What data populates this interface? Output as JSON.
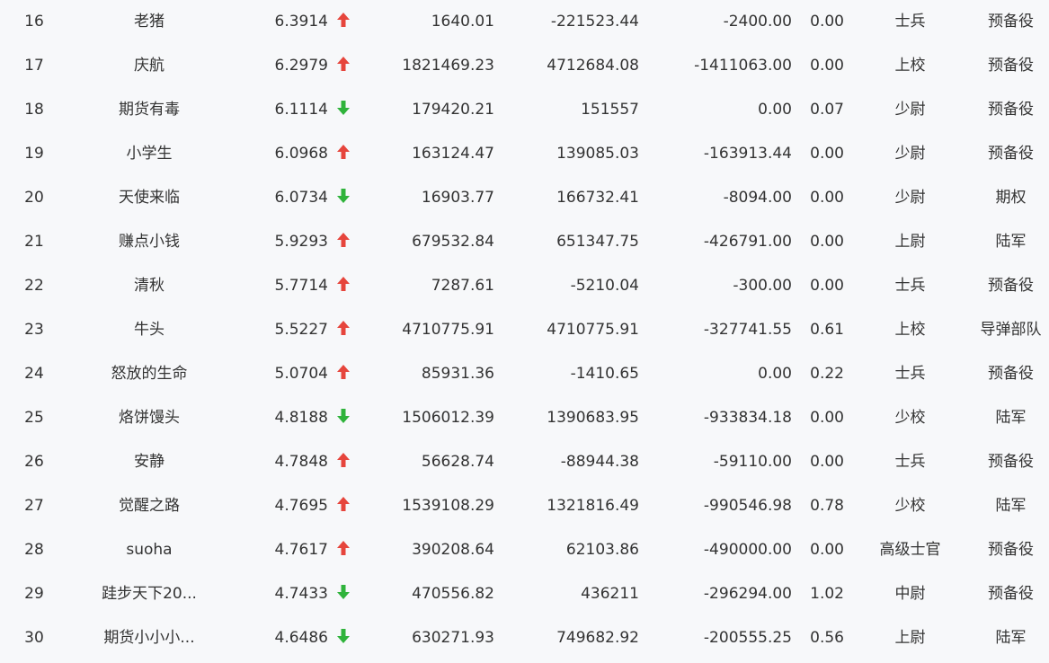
{
  "colors": {
    "up": "#e6453c",
    "down": "#2fb33b"
  },
  "rows": [
    {
      "rank": "16",
      "name": "老猪",
      "score": "6.3914",
      "trend": "up",
      "v1": "1640.01",
      "v2": "-221523.44",
      "v3": "-2400.00",
      "v4": "0.00",
      "rank_title": "士兵",
      "unit": "预备役"
    },
    {
      "rank": "17",
      "name": "庆航",
      "score": "6.2979",
      "trend": "up",
      "v1": "1821469.23",
      "v2": "4712684.08",
      "v3": "-1411063.00",
      "v4": "0.00",
      "rank_title": "上校",
      "unit": "预备役"
    },
    {
      "rank": "18",
      "name": "期货有毒",
      "score": "6.1114",
      "trend": "down",
      "v1": "179420.21",
      "v2": "151557",
      "v3": "0.00",
      "v4": "0.07",
      "rank_title": "少尉",
      "unit": "预备役"
    },
    {
      "rank": "19",
      "name": "小学生",
      "score": "6.0968",
      "trend": "up",
      "v1": "163124.47",
      "v2": "139085.03",
      "v3": "-163913.44",
      "v4": "0.00",
      "rank_title": "少尉",
      "unit": "预备役"
    },
    {
      "rank": "20",
      "name": "天使来临",
      "score": "6.0734",
      "trend": "down",
      "v1": "16903.77",
      "v2": "166732.41",
      "v3": "-8094.00",
      "v4": "0.00",
      "rank_title": "少尉",
      "unit": "期权"
    },
    {
      "rank": "21",
      "name": "赚点小钱",
      "score": "5.9293",
      "trend": "up",
      "v1": "679532.84",
      "v2": "651347.75",
      "v3": "-426791.00",
      "v4": "0.00",
      "rank_title": "上尉",
      "unit": "陆军"
    },
    {
      "rank": "22",
      "name": "清秋",
      "score": "5.7714",
      "trend": "up",
      "v1": "7287.61",
      "v2": "-5210.04",
      "v3": "-300.00",
      "v4": "0.00",
      "rank_title": "士兵",
      "unit": "预备役"
    },
    {
      "rank": "23",
      "name": "牛头",
      "score": "5.5227",
      "trend": "up",
      "v1": "4710775.91",
      "v2": "4710775.91",
      "v3": "-327741.55",
      "v4": "0.61",
      "rank_title": "上校",
      "unit": "导弹部队"
    },
    {
      "rank": "24",
      "name": "怒放的生命",
      "score": "5.0704",
      "trend": "up",
      "v1": "85931.36",
      "v2": "-1410.65",
      "v3": "0.00",
      "v4": "0.22",
      "rank_title": "士兵",
      "unit": "预备役"
    },
    {
      "rank": "25",
      "name": "烙饼馒头",
      "score": "4.8188",
      "trend": "down",
      "v1": "1506012.39",
      "v2": "1390683.95",
      "v3": "-933834.18",
      "v4": "0.00",
      "rank_title": "少校",
      "unit": "陆军"
    },
    {
      "rank": "26",
      "name": "安静",
      "score": "4.7848",
      "trend": "up",
      "v1": "56628.74",
      "v2": "-88944.38",
      "v3": "-59110.00",
      "v4": "0.00",
      "rank_title": "士兵",
      "unit": "预备役"
    },
    {
      "rank": "27",
      "name": "觉醒之路",
      "score": "4.7695",
      "trend": "up",
      "v1": "1539108.29",
      "v2": "1321816.49",
      "v3": "-990546.98",
      "v4": "0.78",
      "rank_title": "少校",
      "unit": "陆军"
    },
    {
      "rank": "28",
      "name": "suoha",
      "score": "4.7617",
      "trend": "up",
      "v1": "390208.64",
      "v2": "62103.86",
      "v3": "-490000.00",
      "v4": "0.00",
      "rank_title": "高级士官",
      "unit": "预备役"
    },
    {
      "rank": "29",
      "name": "跬步天下20...",
      "score": "4.7433",
      "trend": "down",
      "v1": "470556.82",
      "v2": "436211",
      "v3": "-296294.00",
      "v4": "1.02",
      "rank_title": "中尉",
      "unit": "预备役"
    },
    {
      "rank": "30",
      "name": "期货小小小...",
      "score": "4.6486",
      "trend": "down",
      "v1": "630271.93",
      "v2": "749682.92",
      "v3": "-200555.25",
      "v4": "0.56",
      "rank_title": "上尉",
      "unit": "陆军"
    }
  ]
}
